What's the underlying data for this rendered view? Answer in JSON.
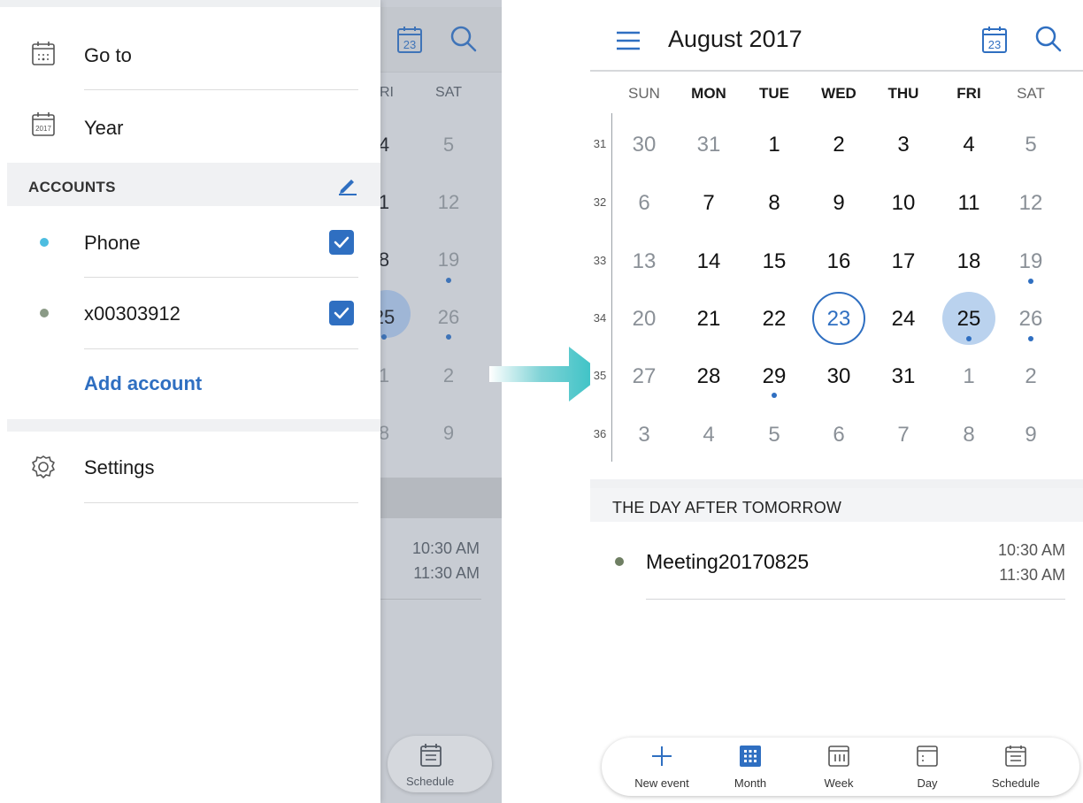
{
  "left": {
    "drawer": {
      "goto_label": "Go to",
      "year_label": "Year",
      "year_icon_text": "2017",
      "accounts_header": "ACCOUNTS",
      "accounts": [
        {
          "name": "Phone",
          "dot_color": "#4dbde0",
          "checked": true
        },
        {
          "name": "x00303912",
          "dot_color": "#8a9a86",
          "checked": true
        }
      ],
      "add_account_label": "Add account",
      "settings_label": "Settings"
    },
    "background": {
      "cal_icon_number": "23",
      "headers": [
        "RI",
        "SAT"
      ],
      "rows": [
        [
          "4",
          "5"
        ],
        [
          "1",
          "12"
        ],
        [
          "8",
          "19"
        ],
        [
          "25",
          "26"
        ],
        [
          "1",
          "2"
        ],
        [
          "8",
          "9"
        ]
      ],
      "times": [
        "10:30 AM",
        "11:30 AM"
      ],
      "nav_label": "Schedule"
    }
  },
  "right": {
    "month_title": "August 2017",
    "cal_icon_number": "23",
    "weekday_headers": [
      "SUN",
      "MON",
      "TUE",
      "WED",
      "THU",
      "FRI",
      "SAT"
    ],
    "week_numbers": [
      "31",
      "32",
      "33",
      "34",
      "35",
      "36"
    ],
    "weeks": [
      [
        "30",
        "31",
        "1",
        "2",
        "3",
        "4",
        "5"
      ],
      [
        "6",
        "7",
        "8",
        "9",
        "10",
        "11",
        "12"
      ],
      [
        "13",
        "14",
        "15",
        "16",
        "17",
        "18",
        "19"
      ],
      [
        "20",
        "21",
        "22",
        "23",
        "24",
        "25",
        "26"
      ],
      [
        "27",
        "28",
        "29",
        "30",
        "31",
        "1",
        "2"
      ],
      [
        "3",
        "4",
        "5",
        "6",
        "7",
        "8",
        "9"
      ]
    ],
    "today": "23",
    "selected": "25",
    "section_title": "THE DAY AFTER TOMORROW",
    "event": {
      "title": "Meeting20170825",
      "start": "10:30 AM",
      "end": "11:30 AM"
    },
    "bottom_nav": [
      {
        "label": "New event",
        "icon": "plus-icon"
      },
      {
        "label": "Month",
        "icon": "month-grid-icon"
      },
      {
        "label": "Week",
        "icon": "week-icon"
      },
      {
        "label": "Day",
        "icon": "day-icon"
      },
      {
        "label": "Schedule",
        "icon": "schedule-icon"
      }
    ],
    "accent_color": "#2f6fc1"
  }
}
